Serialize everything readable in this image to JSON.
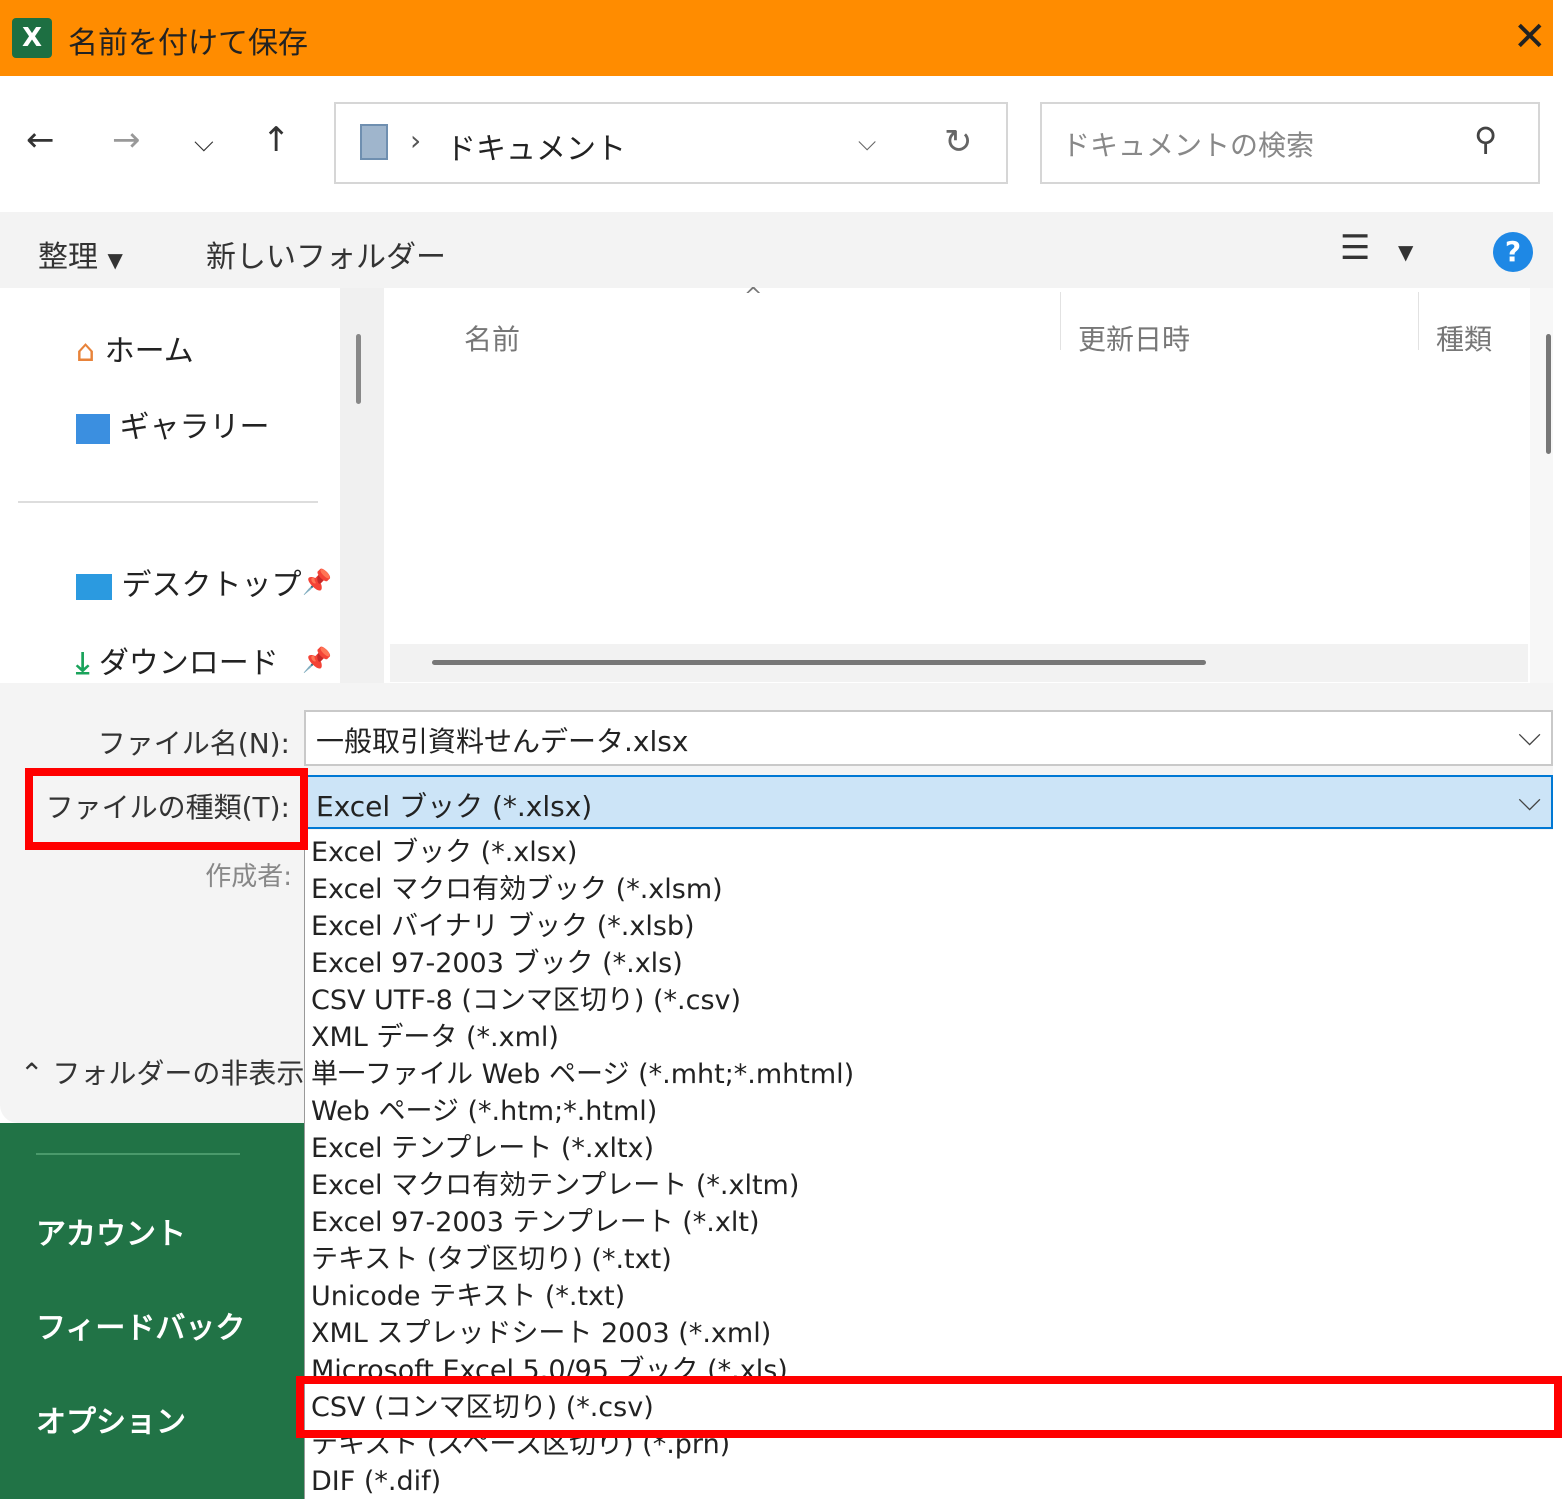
{
  "window": {
    "title": "名前を付けて保存",
    "app_icon": "X"
  },
  "address": {
    "location": "ドキュメント",
    "search_placeholder": "ドキュメントの検索"
  },
  "commands": {
    "organize": "整理",
    "new_folder": "新しいフォルダー"
  },
  "nav": {
    "items": [
      {
        "label": "ホーム",
        "icon": "home-icon"
      },
      {
        "label": "ギャラリー",
        "icon": "gallery-icon"
      },
      {
        "label": "デスクトップ",
        "icon": "desktop-icon",
        "pinned": true
      },
      {
        "label": "ダウンロード",
        "icon": "download-icon",
        "pinned": true
      }
    ]
  },
  "columns": {
    "name": "名前",
    "modified": "更新日時",
    "type": "種類"
  },
  "fields": {
    "filename_label": "ファイル名(N):",
    "filename_value": "一般取引資料せんデータ.xlsx",
    "filetype_label": "ファイルの種類(T):",
    "filetype_value": "Excel ブック (*.xlsx)",
    "author_label": "作成者:"
  },
  "hide_folders": "フォルダーの非表示",
  "backstage": {
    "items": [
      "アカウント",
      "フィードバック",
      "オプション"
    ]
  },
  "filetype_options": [
    "Excel ブック (*.xlsx)",
    "Excel マクロ有効ブック (*.xlsm)",
    "Excel バイナリ ブック (*.xlsb)",
    "Excel 97-2003 ブック (*.xls)",
    "CSV UTF-8 (コンマ区切り) (*.csv)",
    "XML データ (*.xml)",
    "単一ファイル Web ページ (*.mht;*.mhtml)",
    "Web ページ (*.htm;*.html)",
    "Excel テンプレート (*.xltx)",
    "Excel マクロ有効テンプレート (*.xltm)",
    "Excel 97-2003 テンプレート (*.xlt)",
    "テキスト (タブ区切り) (*.txt)",
    "Unicode テキスト (*.txt)",
    "XML スプレッドシート 2003 (*.xml)",
    "Microsoft Excel 5.0/95 ブック (*.xls)",
    "CSV (コンマ区切り) (*.csv)",
    "テキスト (スペース区切り) (*.prn)",
    "DIF (*.dif)"
  ],
  "highlight": {
    "color": "#ff0000"
  }
}
